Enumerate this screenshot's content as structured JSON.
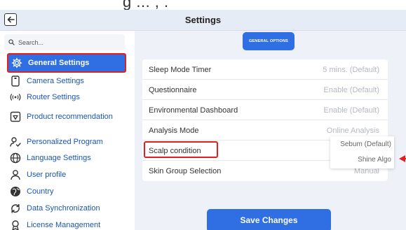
{
  "top_strip": {
    "text": "g ... ,    ."
  },
  "header": {
    "title": "Settings",
    "back_icon": "arrow-left-icon"
  },
  "search": {
    "placeholder": "Search..."
  },
  "sidebar": {
    "items": [
      {
        "label": "General Settings",
        "icon": "gear-icon",
        "active": true
      },
      {
        "label": "Camera Settings",
        "icon": "camera-device-icon"
      },
      {
        "label": "Router Settings",
        "icon": "router-icon"
      },
      {
        "label": "Product recommendation",
        "icon": "product-icon"
      },
      {
        "label": "Personalized Program",
        "icon": "person-check-icon"
      },
      {
        "label": "Language Settings",
        "icon": "globe-icon"
      },
      {
        "label": "User profile",
        "icon": "user-icon"
      },
      {
        "label": "Country",
        "icon": "country-icon"
      },
      {
        "label": "Data Synchronization",
        "icon": "sync-icon"
      },
      {
        "label": "License Management",
        "icon": "license-icon"
      }
    ]
  },
  "general_options": {
    "label": "GENERAL OPTIONS"
  },
  "settings": [
    {
      "label": "Sleep Mode Timer",
      "value": "5 mins. (Default)"
    },
    {
      "label": "Questionnaire",
      "value": "Enable (Default)"
    },
    {
      "label": "Environmental Dashboard",
      "value": "Enable (Default)"
    },
    {
      "label": "Analysis Mode",
      "value": "Online Analysis"
    },
    {
      "label": "Scalp condition",
      "value": ""
    },
    {
      "label": "Skin Group Selection",
      "value": "Manual"
    }
  ],
  "scalp_dropdown": {
    "options": [
      "Sebum (Default)",
      "Shine Algo"
    ]
  },
  "save_button": {
    "label": "Save Changes"
  },
  "colors": {
    "primary": "#2f6fe3",
    "highlight": "#e02020",
    "background": "#eef2f8",
    "header": "#e6ecf6"
  }
}
